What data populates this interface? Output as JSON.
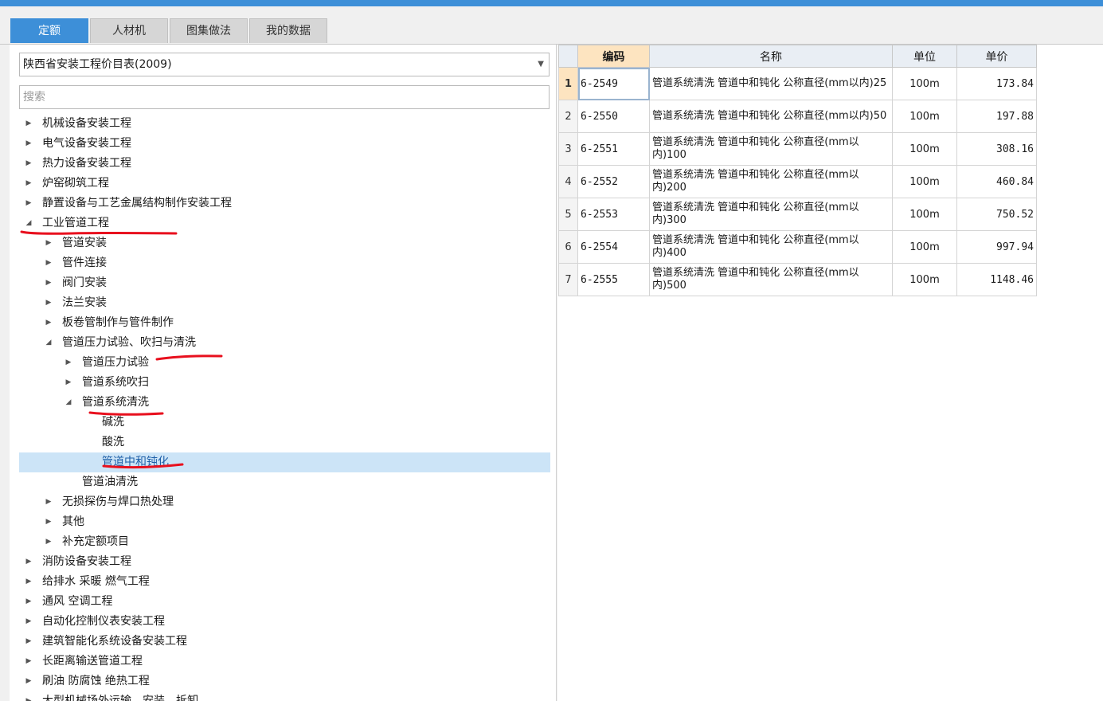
{
  "tabs": [
    "定额",
    "人材机",
    "图集做法",
    "我的数据"
  ],
  "library": {
    "selected": "陕西省安装工程价目表(2009)"
  },
  "search": {
    "placeholder": "搜索"
  },
  "tree": [
    {
      "label": "机械设备安装工程",
      "level": 0,
      "state": "collapsed"
    },
    {
      "label": "电气设备安装工程",
      "level": 0,
      "state": "collapsed"
    },
    {
      "label": "热力设备安装工程",
      "level": 0,
      "state": "collapsed"
    },
    {
      "label": "炉窑砌筑工程",
      "level": 0,
      "state": "collapsed"
    },
    {
      "label": "静置设备与工艺金属结构制作安装工程",
      "level": 0,
      "state": "collapsed"
    },
    {
      "label": "工业管道工程",
      "level": 0,
      "state": "expanded"
    },
    {
      "label": "管道安装",
      "level": 1,
      "state": "collapsed"
    },
    {
      "label": "管件连接",
      "level": 1,
      "state": "collapsed"
    },
    {
      "label": "阀门安装",
      "level": 1,
      "state": "collapsed"
    },
    {
      "label": "法兰安装",
      "level": 1,
      "state": "collapsed"
    },
    {
      "label": "板卷管制作与管件制作",
      "level": 1,
      "state": "collapsed"
    },
    {
      "label": "管道压力试验、吹扫与清洗",
      "level": 1,
      "state": "expanded"
    },
    {
      "label": "管道压力试验",
      "level": 2,
      "state": "collapsed"
    },
    {
      "label": "管道系统吹扫",
      "level": 2,
      "state": "collapsed"
    },
    {
      "label": "管道系统清洗",
      "level": 2,
      "state": "expanded"
    },
    {
      "label": "碱洗",
      "level": 3,
      "state": "leaf"
    },
    {
      "label": "酸洗",
      "level": 3,
      "state": "leaf"
    },
    {
      "label": "管道中和钝化",
      "level": 3,
      "state": "leaf",
      "selected": true
    },
    {
      "label": "管道油清洗",
      "level": 2,
      "state": "leaf"
    },
    {
      "label": "无损探伤与焊口热处理",
      "level": 1,
      "state": "collapsed"
    },
    {
      "label": "其他",
      "level": 1,
      "state": "collapsed"
    },
    {
      "label": "补充定额项目",
      "level": 1,
      "state": "collapsed"
    },
    {
      "label": "消防设备安装工程",
      "level": 0,
      "state": "collapsed"
    },
    {
      "label": "给排水 采暖 燃气工程",
      "level": 0,
      "state": "collapsed"
    },
    {
      "label": "通风 空调工程",
      "level": 0,
      "state": "collapsed"
    },
    {
      "label": "自动化控制仪表安装工程",
      "level": 0,
      "state": "collapsed"
    },
    {
      "label": "建筑智能化系统设备安装工程",
      "level": 0,
      "state": "collapsed"
    },
    {
      "label": "长距离输送管道工程",
      "level": 0,
      "state": "collapsed"
    },
    {
      "label": "刷油 防腐蚀 绝热工程",
      "level": 0,
      "state": "collapsed"
    },
    {
      "label": "大型机械场外运输、安装、拆卸",
      "level": 0,
      "state": "collapsed"
    }
  ],
  "grid": {
    "columns": [
      "编码",
      "名称",
      "单位",
      "单价"
    ],
    "rows": [
      {
        "no": "1",
        "code": "6-2549",
        "name": "管道系统清洗 管道中和钝化 公称直径(mm以内)25",
        "unit": "100m",
        "price": "173.84"
      },
      {
        "no": "2",
        "code": "6-2550",
        "name": "管道系统清洗 管道中和钝化 公称直径(mm以内)50",
        "unit": "100m",
        "price": "197.88"
      },
      {
        "no": "3",
        "code": "6-2551",
        "name": "管道系统清洗 管道中和钝化 公称直径(mm以内)100",
        "unit": "100m",
        "price": "308.16"
      },
      {
        "no": "4",
        "code": "6-2552",
        "name": "管道系统清洗 管道中和钝化 公称直径(mm以内)200",
        "unit": "100m",
        "price": "460.84"
      },
      {
        "no": "5",
        "code": "6-2553",
        "name": "管道系统清洗 管道中和钝化 公称直径(mm以内)300",
        "unit": "100m",
        "price": "750.52"
      },
      {
        "no": "6",
        "code": "6-2554",
        "name": "管道系统清洗 管道中和钝化 公称直径(mm以内)400",
        "unit": "100m",
        "price": "997.94"
      },
      {
        "no": "7",
        "code": "6-2555",
        "name": "管道系统清洗 管道中和钝化 公称直径(mm以内)500",
        "unit": "100m",
        "price": "1148.46"
      }
    ]
  },
  "colors": {
    "accent": "#3d8fd8",
    "selection": "#cce4f7",
    "annotation": "#e8101e",
    "header_code": "#fde4c0"
  }
}
